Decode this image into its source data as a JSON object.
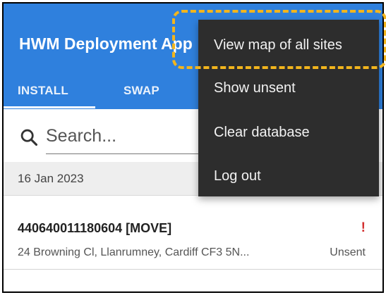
{
  "app": {
    "title": "HWM Deployment App"
  },
  "tabs": [
    {
      "label": "INSTALL"
    },
    {
      "label": "SWAP"
    }
  ],
  "search": {
    "placeholder": "Search...",
    "icon": "search-icon"
  },
  "list": {
    "date_header": "16 Jan 2023",
    "items": [
      {
        "title": "440640011180604 [MOVE]",
        "alert": "!",
        "address": "24 Browning Cl, Llanrumney, Cardiff CF3 5N...",
        "status": "Unsent"
      }
    ]
  },
  "menu": {
    "items": [
      {
        "label": "View map of all sites"
      },
      {
        "label": "Show unsent"
      },
      {
        "label": "Clear database"
      },
      {
        "label": "Log out"
      }
    ]
  },
  "colors": {
    "app_bar": "#2f80dd",
    "menu_bg": "#2d2d2d",
    "highlight": "#f2b51d",
    "alert": "#d32f2f"
  }
}
